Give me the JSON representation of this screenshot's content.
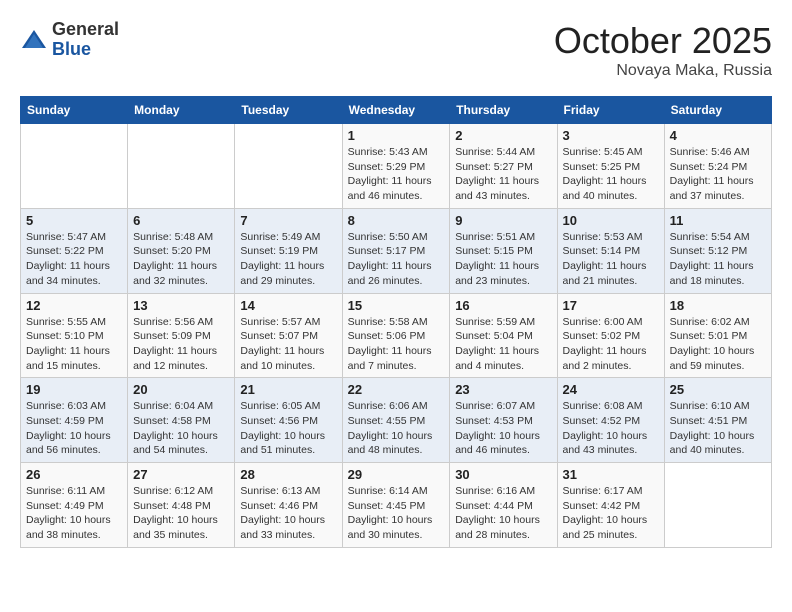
{
  "logo": {
    "general": "General",
    "blue": "Blue"
  },
  "title": "October 2025",
  "location": "Novaya Maka, Russia",
  "weekdays": [
    "Sunday",
    "Monday",
    "Tuesday",
    "Wednesday",
    "Thursday",
    "Friday",
    "Saturday"
  ],
  "weeks": [
    [
      {
        "day": "",
        "info": ""
      },
      {
        "day": "",
        "info": ""
      },
      {
        "day": "",
        "info": ""
      },
      {
        "day": "1",
        "info": "Sunrise: 5:43 AM\nSunset: 5:29 PM\nDaylight: 11 hours and 46 minutes."
      },
      {
        "day": "2",
        "info": "Sunrise: 5:44 AM\nSunset: 5:27 PM\nDaylight: 11 hours and 43 minutes."
      },
      {
        "day": "3",
        "info": "Sunrise: 5:45 AM\nSunset: 5:25 PM\nDaylight: 11 hours and 40 minutes."
      },
      {
        "day": "4",
        "info": "Sunrise: 5:46 AM\nSunset: 5:24 PM\nDaylight: 11 hours and 37 minutes."
      }
    ],
    [
      {
        "day": "5",
        "info": "Sunrise: 5:47 AM\nSunset: 5:22 PM\nDaylight: 11 hours and 34 minutes."
      },
      {
        "day": "6",
        "info": "Sunrise: 5:48 AM\nSunset: 5:20 PM\nDaylight: 11 hours and 32 minutes."
      },
      {
        "day": "7",
        "info": "Sunrise: 5:49 AM\nSunset: 5:19 PM\nDaylight: 11 hours and 29 minutes."
      },
      {
        "day": "8",
        "info": "Sunrise: 5:50 AM\nSunset: 5:17 PM\nDaylight: 11 hours and 26 minutes."
      },
      {
        "day": "9",
        "info": "Sunrise: 5:51 AM\nSunset: 5:15 PM\nDaylight: 11 hours and 23 minutes."
      },
      {
        "day": "10",
        "info": "Sunrise: 5:53 AM\nSunset: 5:14 PM\nDaylight: 11 hours and 21 minutes."
      },
      {
        "day": "11",
        "info": "Sunrise: 5:54 AM\nSunset: 5:12 PM\nDaylight: 11 hours and 18 minutes."
      }
    ],
    [
      {
        "day": "12",
        "info": "Sunrise: 5:55 AM\nSunset: 5:10 PM\nDaylight: 11 hours and 15 minutes."
      },
      {
        "day": "13",
        "info": "Sunrise: 5:56 AM\nSunset: 5:09 PM\nDaylight: 11 hours and 12 minutes."
      },
      {
        "day": "14",
        "info": "Sunrise: 5:57 AM\nSunset: 5:07 PM\nDaylight: 11 hours and 10 minutes."
      },
      {
        "day": "15",
        "info": "Sunrise: 5:58 AM\nSunset: 5:06 PM\nDaylight: 11 hours and 7 minutes."
      },
      {
        "day": "16",
        "info": "Sunrise: 5:59 AM\nSunset: 5:04 PM\nDaylight: 11 hours and 4 minutes."
      },
      {
        "day": "17",
        "info": "Sunrise: 6:00 AM\nSunset: 5:02 PM\nDaylight: 11 hours and 2 minutes."
      },
      {
        "day": "18",
        "info": "Sunrise: 6:02 AM\nSunset: 5:01 PM\nDaylight: 10 hours and 59 minutes."
      }
    ],
    [
      {
        "day": "19",
        "info": "Sunrise: 6:03 AM\nSunset: 4:59 PM\nDaylight: 10 hours and 56 minutes."
      },
      {
        "day": "20",
        "info": "Sunrise: 6:04 AM\nSunset: 4:58 PM\nDaylight: 10 hours and 54 minutes."
      },
      {
        "day": "21",
        "info": "Sunrise: 6:05 AM\nSunset: 4:56 PM\nDaylight: 10 hours and 51 minutes."
      },
      {
        "day": "22",
        "info": "Sunrise: 6:06 AM\nSunset: 4:55 PM\nDaylight: 10 hours and 48 minutes."
      },
      {
        "day": "23",
        "info": "Sunrise: 6:07 AM\nSunset: 4:53 PM\nDaylight: 10 hours and 46 minutes."
      },
      {
        "day": "24",
        "info": "Sunrise: 6:08 AM\nSunset: 4:52 PM\nDaylight: 10 hours and 43 minutes."
      },
      {
        "day": "25",
        "info": "Sunrise: 6:10 AM\nSunset: 4:51 PM\nDaylight: 10 hours and 40 minutes."
      }
    ],
    [
      {
        "day": "26",
        "info": "Sunrise: 6:11 AM\nSunset: 4:49 PM\nDaylight: 10 hours and 38 minutes."
      },
      {
        "day": "27",
        "info": "Sunrise: 6:12 AM\nSunset: 4:48 PM\nDaylight: 10 hours and 35 minutes."
      },
      {
        "day": "28",
        "info": "Sunrise: 6:13 AM\nSunset: 4:46 PM\nDaylight: 10 hours and 33 minutes."
      },
      {
        "day": "29",
        "info": "Sunrise: 6:14 AM\nSunset: 4:45 PM\nDaylight: 10 hours and 30 minutes."
      },
      {
        "day": "30",
        "info": "Sunrise: 6:16 AM\nSunset: 4:44 PM\nDaylight: 10 hours and 28 minutes."
      },
      {
        "day": "31",
        "info": "Sunrise: 6:17 AM\nSunset: 4:42 PM\nDaylight: 10 hours and 25 minutes."
      },
      {
        "day": "",
        "info": ""
      }
    ]
  ]
}
